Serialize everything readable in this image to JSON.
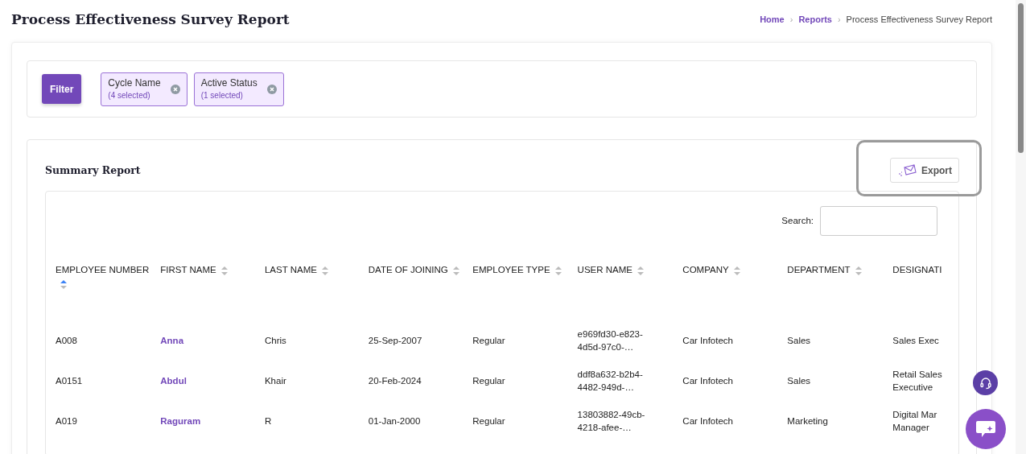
{
  "page_title": "Process Effectiveness Survey Report",
  "breadcrumb_separator": "›",
  "breadcrumb": [
    {
      "label": "Home",
      "link": true
    },
    {
      "label": "Reports",
      "link": true
    },
    {
      "label": "Process Effectiveness Survey Report",
      "link": false
    }
  ],
  "filter": {
    "button": "Filter",
    "chips": [
      {
        "label": "Cycle Name",
        "count": "(4 selected)"
      },
      {
        "label": "Active Status",
        "count": "(1 selected)"
      }
    ]
  },
  "summary": {
    "title": "Summary Report",
    "export_button": "Export",
    "export_highlighted": true,
    "search_label": "Search:"
  },
  "table": {
    "columns": [
      {
        "label": "EMPLOYEE NUMBER",
        "sorted": true
      },
      {
        "label": "FIRST NAME",
        "sorted": false
      },
      {
        "label": "LAST NAME",
        "sorted": false
      },
      {
        "label": "DATE OF JOINING",
        "sorted": false
      },
      {
        "label": "EMPLOYEE TYPE",
        "sorted": false
      },
      {
        "label": "USER NAME",
        "sorted": false
      },
      {
        "label": "COMPANY",
        "sorted": false
      },
      {
        "label": "DEPARTMENT",
        "sorted": false
      },
      {
        "label": "DESIGNATI"
      }
    ],
    "rows": [
      [
        "A008",
        "Anna",
        "Chris",
        "25-Sep-2007",
        "Regular",
        "e969fd30-e823-4d5d-97c0-…",
        "Car Infotech",
        "Sales",
        "Sales Exec"
      ],
      [
        "A0151",
        "Abdul",
        "Khair",
        "20-Feb-2024",
        "Regular",
        "ddf8a632-b2b4-4482-949d-…",
        "Car Infotech",
        "Sales",
        "Retail Sales Executive"
      ],
      [
        "A019",
        "Raguram",
        "R",
        "01-Jan-2000",
        "Regular",
        "13803882-49cb-4218-afee-…",
        "Car Infotech",
        "Marketing",
        "Digital Mar Manager"
      ]
    ]
  }
}
